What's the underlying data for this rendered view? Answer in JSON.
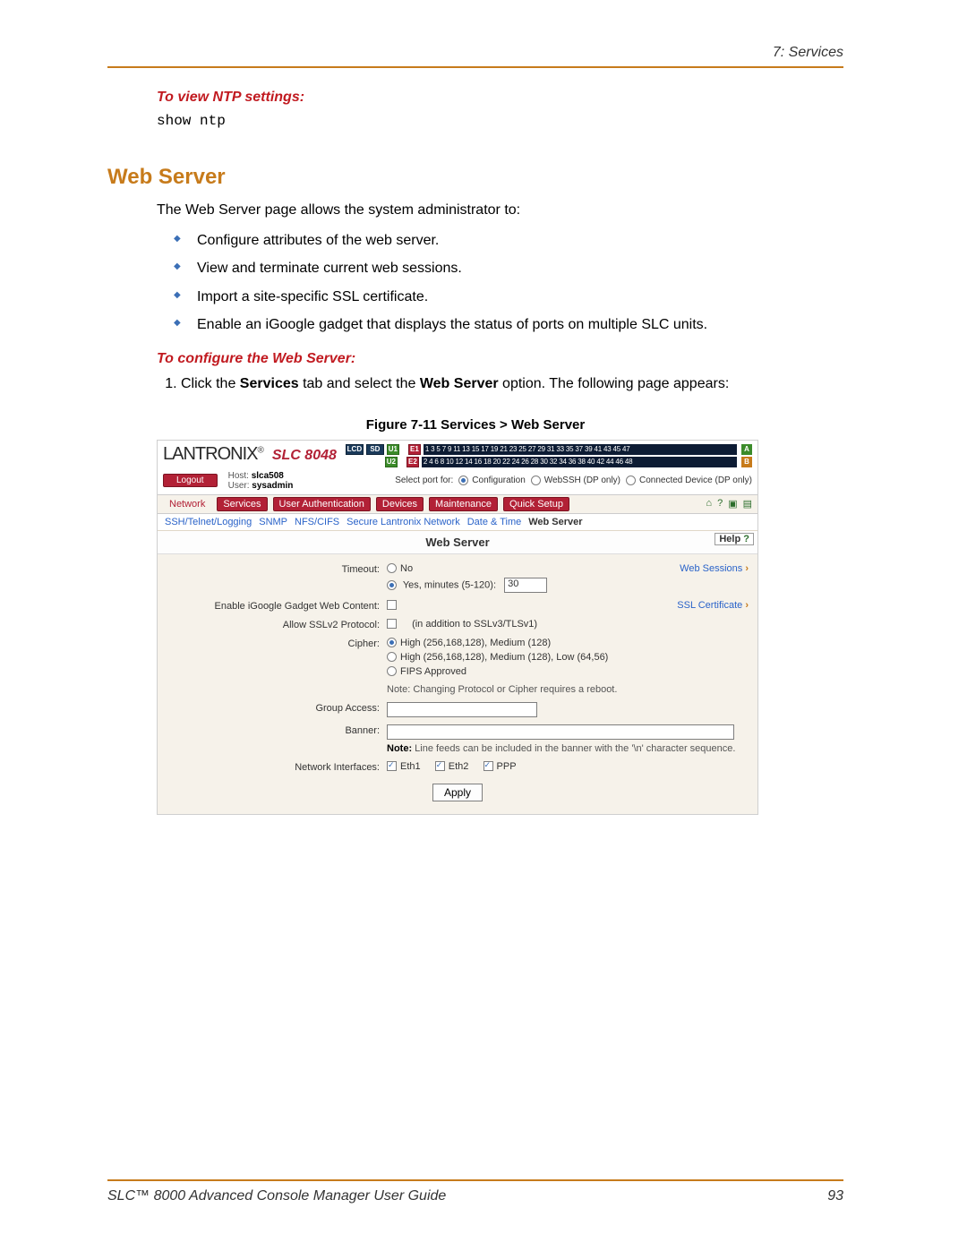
{
  "header": {
    "section_label": "7: Services"
  },
  "intro_heading": "To view NTP settings:",
  "command": "show ntp",
  "section_title": "Web Server",
  "intro_text": "The Web Server page allows the system administrator to:",
  "bullets": [
    "Configure attributes of the web server.",
    "View and terminate current web sessions.",
    "Import a site-specific SSL certificate.",
    "Enable an iGoogle gadget that displays the status of ports on multiple SLC units."
  ],
  "configure_heading": "To configure the Web Server:",
  "step_prefix": "Click the ",
  "step_tab_bold": "Services",
  "step_mid": " tab and select the ",
  "step_opt_bold": "Web Server",
  "step_suffix": " option.  The following page appears:",
  "figure_caption": "Figure 7-11  Services  > Web Server",
  "shot": {
    "logo": "LANTRONIX",
    "reg": "®",
    "product": "SLC 8048",
    "lcd": "LCD",
    "sd": "SD",
    "u1": "U1",
    "u2": "U2",
    "e1": "E1",
    "e2": "E2",
    "ports_row1": "1  3  5  7  9 11 13 15 17 19 21 23 25 27 29 31 33 35 37 39 41 43 45 47",
    "ports_row2": "2  4  6  8 10 12 14 16 18 20 22 24 26 28 30 32 34 36 38 40 42 44 46 48",
    "chip_a": "A",
    "chip_b": "B",
    "logout": "Logout",
    "host_label": "Host:",
    "host_value": "slca508",
    "user_label": "User:",
    "user_value": "sysadmin",
    "select_port_for": "Select port for:",
    "sp_configuration": "Configuration",
    "sp_webssh": "WebSSH (DP only)",
    "sp_connected": "Connected Device (DP only)",
    "tabs": {
      "network": "Network",
      "services": "Services",
      "user_auth": "User Authentication",
      "devices": "Devices",
      "maintenance": "Maintenance",
      "quick_setup": "Quick Setup"
    },
    "icons": {
      "home": "⌂",
      "help": "?",
      "expand": "▣",
      "list": "▤"
    },
    "subtabs": {
      "ssh": "SSH/Telnet/Logging",
      "snmp": "SNMP",
      "nfs": "NFS/CIFS",
      "sln": "Secure Lantronix Network",
      "dt": "Date & Time",
      "web": "Web Server"
    },
    "panel_title": "Web Server",
    "help_button": "Help",
    "labels": {
      "timeout": "Timeout:",
      "timeout_no": "No",
      "timeout_yes": "Yes, minutes (5-120):",
      "timeout_val": "30",
      "igoogle": "Enable iGoogle Gadget Web Content:",
      "sslv2": "Allow SSLv2 Protocol:",
      "sslv2_hint": "(in addition to SSLv3/TLSv1)",
      "cipher": "Cipher:",
      "cipher1": "High (256,168,128), Medium (128)",
      "cipher2": "High (256,168,128), Medium (128), Low (64,56)",
      "cipher3": "FIPS Approved",
      "note_proto": "Note: Changing Protocol or Cipher requires a reboot.",
      "group": "Group Access:",
      "banner": "Banner:",
      "banner_note_bold": "Note:",
      "banner_note": " Line feeds can be included in the banner with the '\\n' character sequence.",
      "nics": "Network Interfaces:",
      "eth1": "Eth1",
      "eth2": "Eth2",
      "ppp": "PPP",
      "apply": "Apply",
      "web_sessions": "Web Sessions",
      "ssl_cert": "SSL Certificate"
    }
  },
  "footer": {
    "left": "SLC™ 8000 Advanced Console Manager User Guide",
    "page": "93"
  }
}
